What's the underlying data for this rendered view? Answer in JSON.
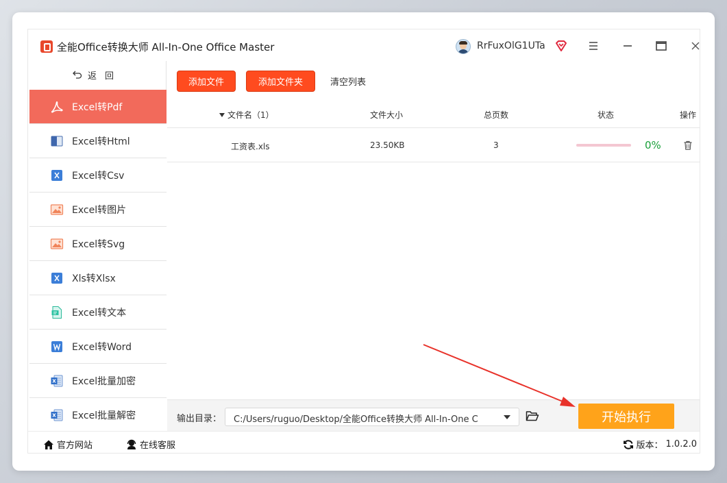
{
  "window": {
    "title": "全能Office转换大师 All-In-One Office Master",
    "username": "RrFuxOlG1UTa"
  },
  "sidebar": {
    "back_label": "返回",
    "items": [
      {
        "label": "Excel转Pdf",
        "icon": "pdf-icon",
        "active": true
      },
      {
        "label": "Excel转Html",
        "icon": "html-icon",
        "active": false
      },
      {
        "label": "Excel转Csv",
        "icon": "excel-icon",
        "active": false
      },
      {
        "label": "Excel转图片",
        "icon": "image-icon",
        "active": false
      },
      {
        "label": "Excel转Svg",
        "icon": "image-icon",
        "active": false
      },
      {
        "label": "Xls转Xlsx",
        "icon": "excel-icon",
        "active": false
      },
      {
        "label": "Excel转文本",
        "icon": "text-doc-icon",
        "active": false
      },
      {
        "label": "Excel转Word",
        "icon": "word-icon",
        "active": false
      },
      {
        "label": "Excel批量加密",
        "icon": "excel-lock-icon",
        "active": false
      },
      {
        "label": "Excel批量解密",
        "icon": "excel-unlock-icon",
        "active": false
      }
    ]
  },
  "toolbar": {
    "add_file_label": "添加文件",
    "add_folder_label": "添加文件夹",
    "clear_label": "清空列表"
  },
  "table": {
    "headers": {
      "name": "文件名（1）",
      "size": "文件大小",
      "pages": "总页数",
      "status": "状态",
      "action": "操作"
    },
    "rows": [
      {
        "name": "工资表.xls",
        "size": "23.50KB",
        "pages": "3",
        "progress": 0,
        "progress_text": "0%"
      }
    ]
  },
  "output": {
    "label": "输出目录：",
    "path": "C:/Users/ruguo/Desktop/全能Office转换大师 All-In-One C"
  },
  "start_label": "开始执行",
  "footer": {
    "site_label": "官方网站",
    "service_label": "在线客服",
    "version_label": "版本：",
    "version_value": "1.0.2.0"
  },
  "colors": {
    "active_nav": "#f26a5b",
    "primary_button": "#ff4b1f",
    "start_button": "#ffa31a",
    "progress_text": "#1aa03a",
    "annotation_arrow": "#e8322a"
  }
}
